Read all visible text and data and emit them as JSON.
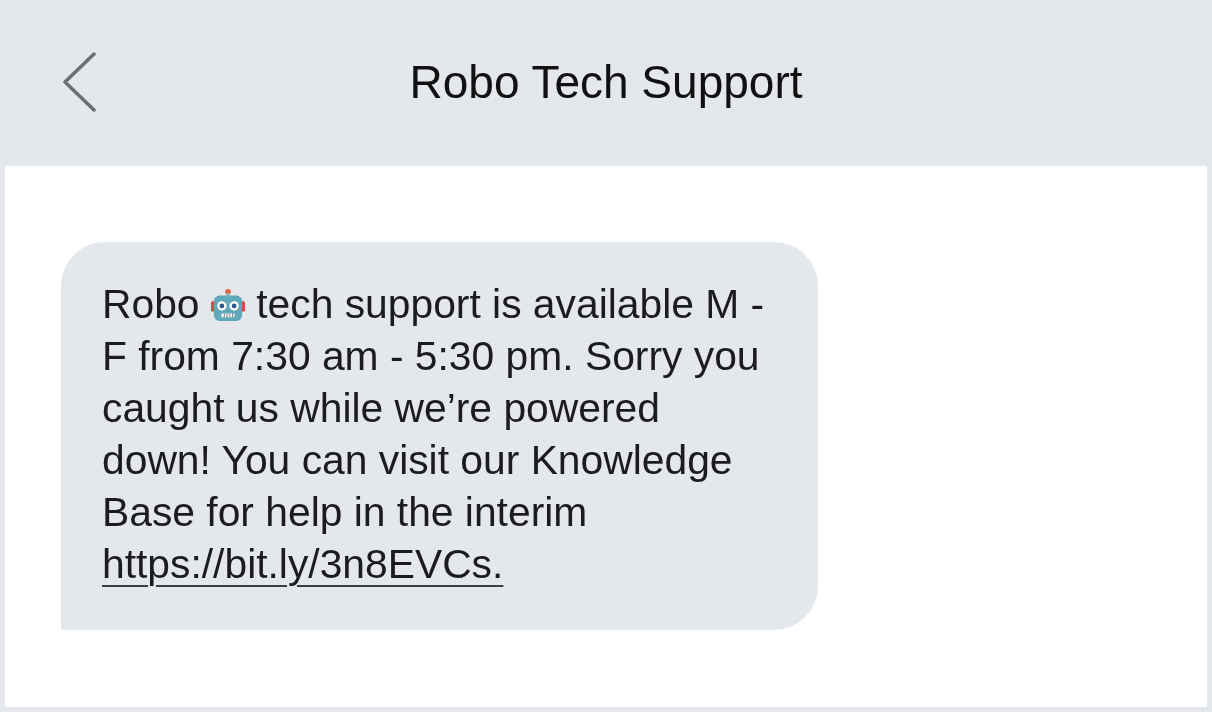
{
  "header": {
    "title": "Robo Tech Support"
  },
  "messages": [
    {
      "kind": "received",
      "text_before": "Robo",
      "text_after": "tech support is available M - F from 7:30 am - 5:30 pm. Sorry you caught us while we’re powered down! You can visit our Knowledge Base for help in the interim",
      "link": "https://bit.ly/3n8EVCs."
    }
  ]
}
